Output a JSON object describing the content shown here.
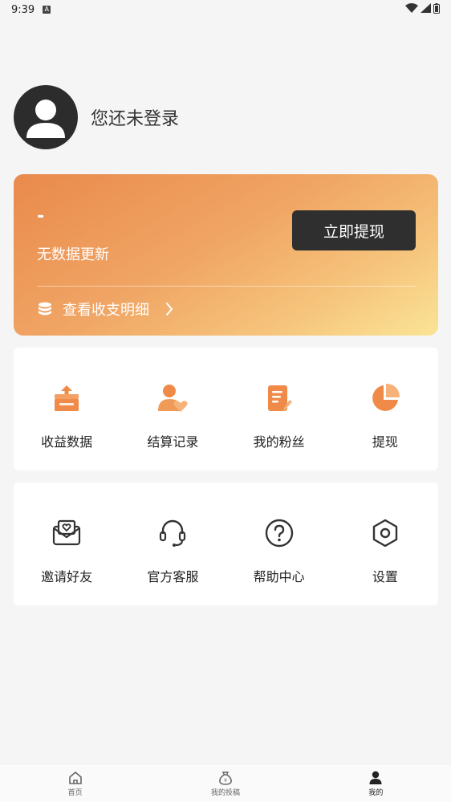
{
  "status_bar": {
    "time": "9:39",
    "badge": "A"
  },
  "profile": {
    "login_text": "您还未登录"
  },
  "balance_card": {
    "amount": "-",
    "subtitle": "无数据更新",
    "withdraw_button": "立即提现",
    "details_link": "查看收支明细"
  },
  "grid_primary": [
    {
      "label": "收益数据",
      "icon": "inbox-upload-icon"
    },
    {
      "label": "结算记录",
      "icon": "user-heart-icon"
    },
    {
      "label": "我的粉丝",
      "icon": "document-edit-icon"
    },
    {
      "label": "提现",
      "icon": "pie-chart-icon"
    }
  ],
  "grid_secondary": [
    {
      "label": "邀请好友",
      "icon": "envelope-heart-icon"
    },
    {
      "label": "官方客服",
      "icon": "headset-icon"
    },
    {
      "label": "帮助中心",
      "icon": "question-circle-icon"
    },
    {
      "label": "设置",
      "icon": "hexagon-settings-icon"
    }
  ],
  "bottom_nav": [
    {
      "label": "首页",
      "icon": "home-icon"
    },
    {
      "label": "我的投稿",
      "icon": "money-bag-icon"
    },
    {
      "label": "我的",
      "icon": "person-icon"
    }
  ],
  "colors": {
    "accent": "#ef8a49",
    "card_gradient_start": "#e98a4c",
    "card_gradient_end": "#fae496",
    "button_dark": "#2f2f2f"
  }
}
